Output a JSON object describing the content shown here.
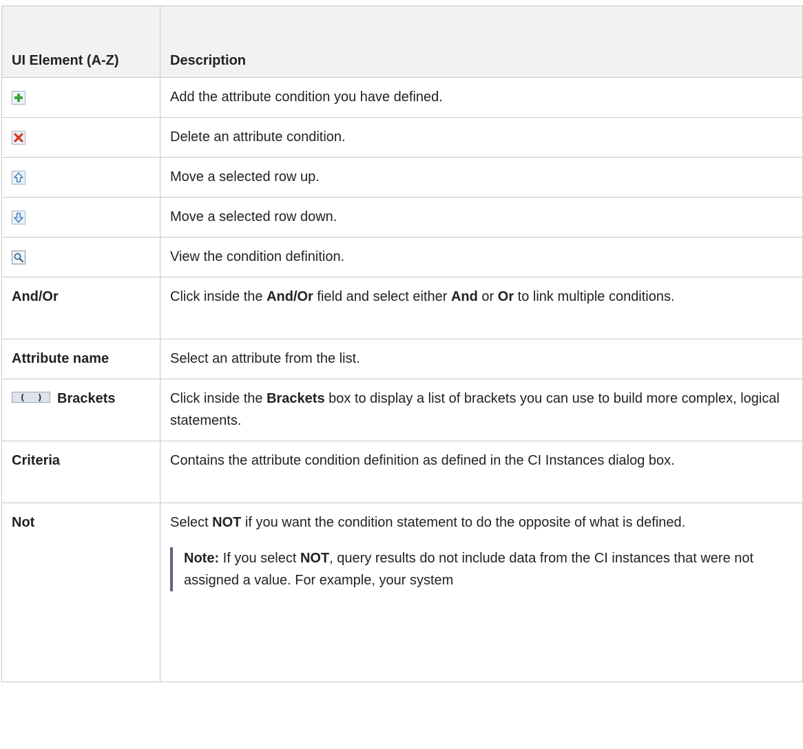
{
  "table": {
    "headers": [
      "UI Element (A-Z)",
      "Description"
    ],
    "rows": [
      {
        "element_icon": "add-icon",
        "element": "",
        "description": "Add the attribute condition you have defined."
      },
      {
        "element_icon": "delete-icon",
        "element": "",
        "description": "Delete an attribute condition."
      },
      {
        "element_icon": "move-up-icon",
        "element": "",
        "description": "Move a selected row up."
      },
      {
        "element_icon": "move-down-icon",
        "element": "",
        "description": "Move a selected row down."
      },
      {
        "element_icon": "view-icon",
        "element": "",
        "description": "View the condition definition."
      },
      {
        "element": "And/Or",
        "description_parts": [
          "Click inside the ",
          "And/Or",
          " field and select either ",
          "And",
          " or ",
          "Or",
          " to link multiple conditions."
        ]
      },
      {
        "element": "Attribute name",
        "description": "Select an attribute from the list."
      },
      {
        "element_icon": "brackets-icon",
        "element": "Brackets",
        "description_parts": [
          "Click inside the ",
          "Brackets",
          " box to display a list of brackets you can use to build more complex, logical statements."
        ]
      },
      {
        "element": "Criteria",
        "description": "Contains the attribute condition definition as defined in the CI Instances dialog box."
      },
      {
        "element": "Not",
        "description_parts": [
          "Select ",
          "NOT",
          " if you want the condition statement to do the opposite of what is defined."
        ],
        "note": {
          "label": "Note:",
          "parts": [
            " If you select ",
            "NOT",
            ", query results do not include data from the CI instances that were not assigned a value. For example, your system"
          ]
        }
      }
    ]
  },
  "colors": {
    "accent_note_bar": "#6b5c7e",
    "header_bg": "#f2f2f2",
    "border": "#c8c8c8"
  }
}
